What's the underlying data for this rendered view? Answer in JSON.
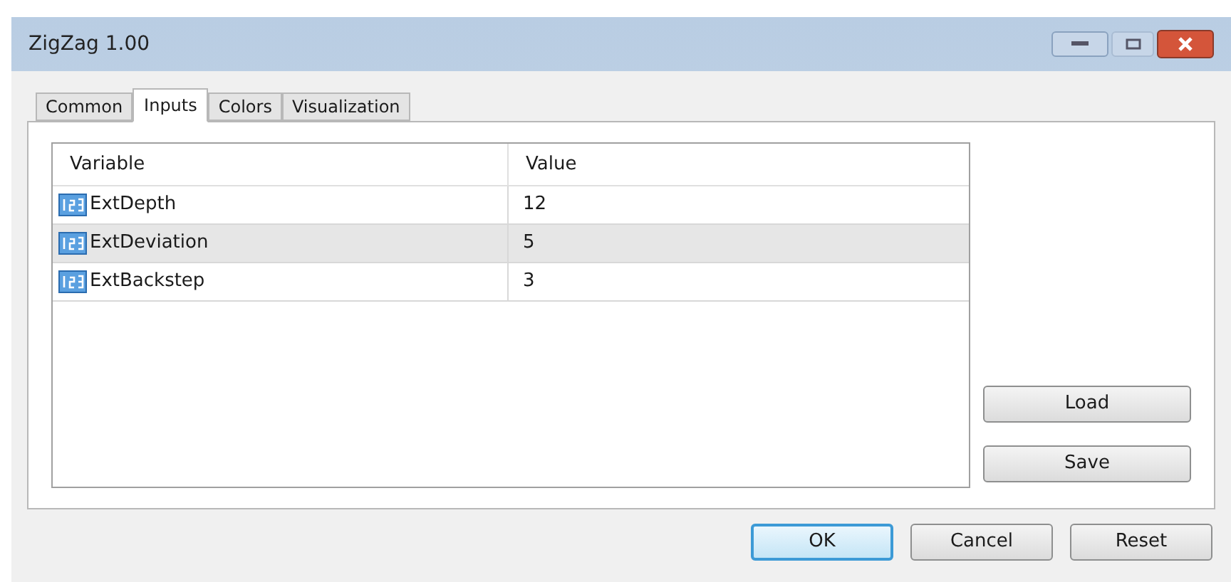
{
  "window": {
    "title": "ZigZag 1.00"
  },
  "tabs": [
    {
      "label": "Common",
      "selected": false
    },
    {
      "label": "Inputs",
      "selected": true
    },
    {
      "label": "Colors",
      "selected": false
    },
    {
      "label": "Visualization",
      "selected": false
    }
  ],
  "table": {
    "columns": [
      "Variable",
      "Value"
    ],
    "rows": [
      {
        "variable": "ExtDepth",
        "value": "12",
        "selected": false
      },
      {
        "variable": "ExtDeviation",
        "value": "5",
        "selected": true
      },
      {
        "variable": "ExtBackstep",
        "value": "3",
        "selected": false
      }
    ]
  },
  "side_buttons": [
    "Load",
    "Save"
  ],
  "buttons": [
    {
      "label": "OK",
      "default": true
    },
    {
      "label": "Cancel",
      "default": false
    },
    {
      "label": "Reset",
      "default": false
    }
  ]
}
